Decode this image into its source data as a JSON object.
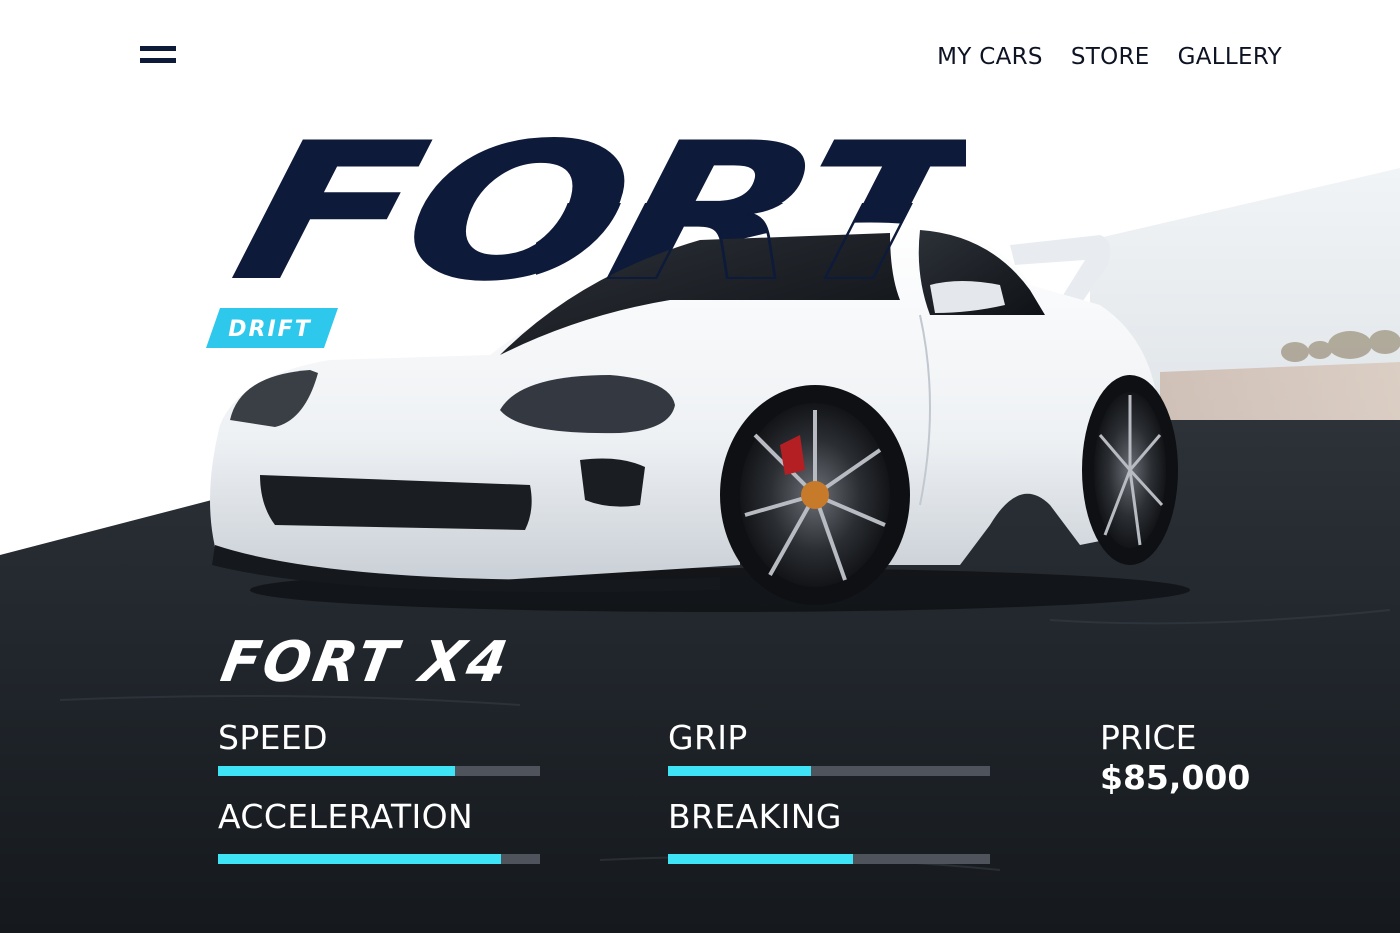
{
  "nav": {
    "items": [
      {
        "label": "MY CARS"
      },
      {
        "label": "STORE"
      },
      {
        "label": "GALLERY"
      }
    ]
  },
  "hero": {
    "title": "FORT",
    "badge": "DRIFT"
  },
  "model": {
    "name": "FORT X4"
  },
  "stats": [
    {
      "label": "SPEED",
      "level": 0.737
    },
    {
      "label": "GRIP",
      "level": 0.444
    },
    {
      "label": "ACCELERATION",
      "level": 0.88
    },
    {
      "label": "BREAKING",
      "level": 0.575
    }
  ],
  "price": {
    "label": "PRICE",
    "value": "$85,000"
  },
  "colors": {
    "navy": "#0d1a3a",
    "accent": "#3ee3f6",
    "track": "#4f545c",
    "car_body": "#f2f4f6"
  }
}
